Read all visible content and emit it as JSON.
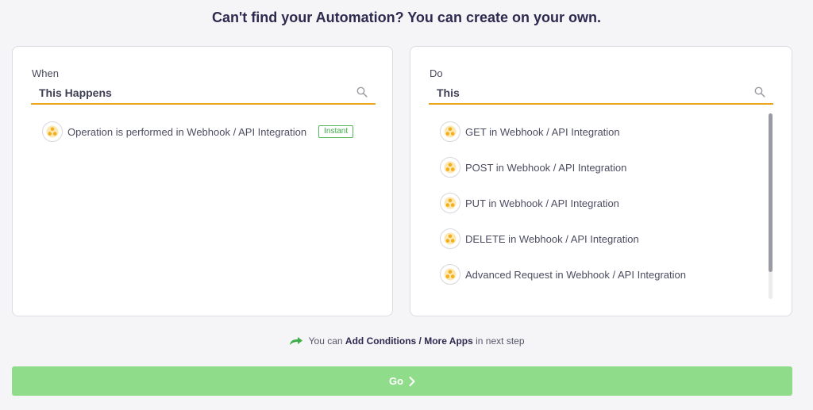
{
  "header": {
    "title": "Can't find your Automation? You can create on your own."
  },
  "when_panel": {
    "label": "When",
    "search_placeholder": "This Happens",
    "items": [
      {
        "label": "Operation is performed in Webhook / API Integration",
        "badge": "Instant",
        "icon": "webhook-icon"
      }
    ]
  },
  "do_panel": {
    "label": "Do",
    "search_placeholder": "This",
    "items": [
      {
        "label": "GET in Webhook / API Integration",
        "icon": "webhook-icon"
      },
      {
        "label": "POST in Webhook / API Integration",
        "icon": "webhook-icon"
      },
      {
        "label": "PUT in Webhook / API Integration",
        "icon": "webhook-icon"
      },
      {
        "label": "DELETE in Webhook / API Integration",
        "icon": "webhook-icon"
      },
      {
        "label": "Advanced Request in Webhook / API Integration",
        "icon": "webhook-icon"
      }
    ]
  },
  "hint": {
    "prefix": "You can",
    "emphasis": "Add Conditions / More Apps",
    "suffix": "in next step",
    "icon": "forward-arrow-icon"
  },
  "go_button": {
    "label": "Go",
    "icon": "chevron-right-icon"
  },
  "colors": {
    "accent_underline": "#e8a51d",
    "go_button": "#8fdd8a",
    "badge_green": "#54b85c",
    "webhook_icon": "#f2b01e"
  }
}
